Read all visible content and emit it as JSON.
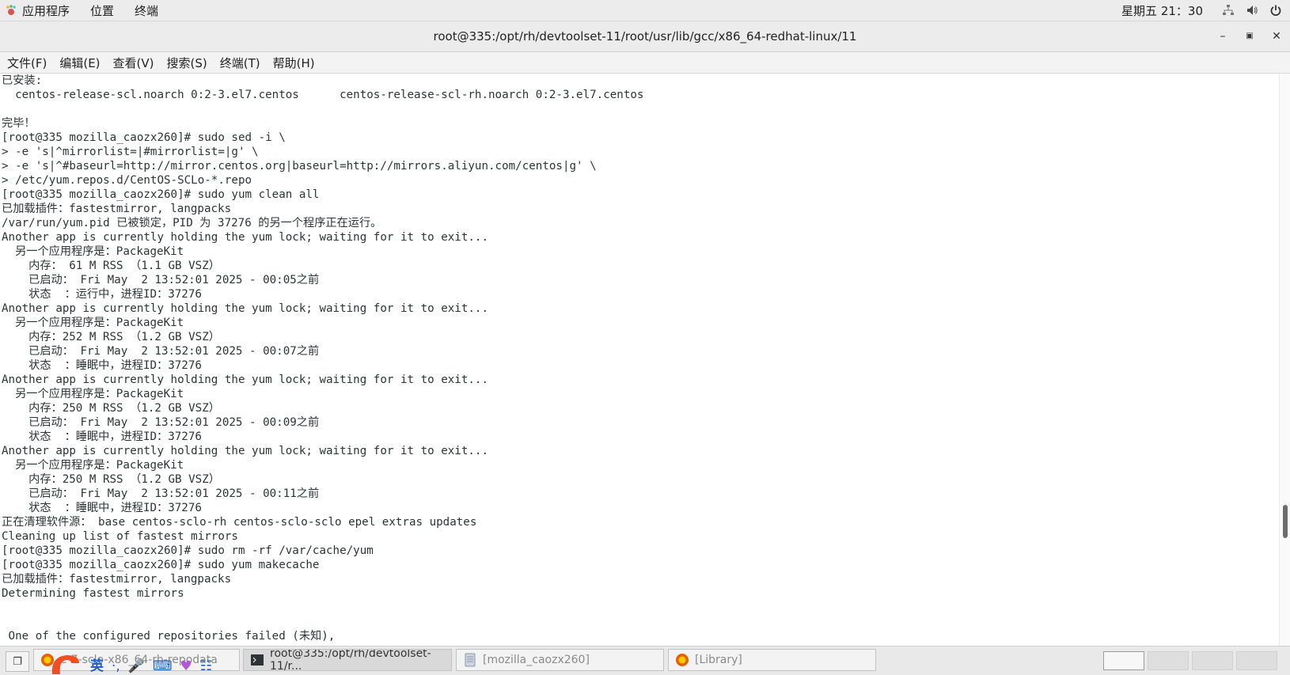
{
  "topbar": {
    "applications": "应用程序",
    "places": "位置",
    "terminal": "终端",
    "clock": "星期五 21：30"
  },
  "window": {
    "title": "root@335:/opt/rh/devtoolset-11/root/usr/lib/gcc/x86_64-redhat-linux/11"
  },
  "menubar": {
    "items": [
      "文件(F)",
      "编辑(E)",
      "查看(V)",
      "搜索(S)",
      "终端(T)",
      "帮助(H)"
    ]
  },
  "terminal": {
    "lines": [
      "已安装:",
      "  centos-release-scl.noarch 0:2-3.el7.centos      centos-release-scl-rh.noarch 0:2-3.el7.centos",
      "",
      "完毕！",
      "[root@335 mozilla_caozx260]# sudo sed -i \\",
      "> -e 's|^mirrorlist=|#mirrorlist=|g' \\",
      "> -e 's|^#baseurl=http://mirror.centos.org|baseurl=http://mirrors.aliyun.com/centos|g' \\",
      "> /etc/yum.repos.d/CentOS-SCLo-*.repo",
      "[root@335 mozilla_caozx260]# sudo yum clean all",
      "已加载插件：fastestmirror, langpacks",
      "/var/run/yum.pid 已被锁定，PID 为 37276 的另一个程序正在运行。",
      "Another app is currently holding the yum lock; waiting for it to exit...",
      "  另一个应用程序是：PackageKit",
      "    内存： 61 M RSS （1.1 GB VSZ）",
      "    已启动： Fri May  2 13:52:01 2025 - 00:05之前",
      "    状态  ：运行中，进程ID：37276",
      "Another app is currently holding the yum lock; waiting for it to exit...",
      "  另一个应用程序是：PackageKit",
      "    内存：252 M RSS （1.2 GB VSZ）",
      "    已启动： Fri May  2 13:52:01 2025 - 00:07之前",
      "    状态  ：睡眠中，进程ID：37276",
      "Another app is currently holding the yum lock; waiting for it to exit...",
      "  另一个应用程序是：PackageKit",
      "    内存：250 M RSS （1.2 GB VSZ）",
      "    已启动： Fri May  2 13:52:01 2025 - 00:09之前",
      "    状态  ：睡眠中，进程ID：37276",
      "Another app is currently holding the yum lock; waiting for it to exit...",
      "  另一个应用程序是：PackageKit",
      "    内存：250 M RSS （1.2 GB VSZ）",
      "    已启动： Fri May  2 13:52:01 2025 - 00:11之前",
      "    状态  ：睡眠中，进程ID：37276",
      "正在清理软件源： base centos-sclo-rh centos-sclo-sclo epel extras updates",
      "Cleaning up list of fastest mirrors",
      "[root@335 mozilla_caozx260]# sudo rm -rf /var/cache/yum",
      "[root@335 mozilla_caozx260]# sudo yum makecache",
      "已加载插件：fastestmirror, langpacks",
      "Determining fastest mirrors",
      "",
      "",
      " One of the configured repositories failed (未知),"
    ]
  },
  "taskbar": {
    "tasks": [
      {
        "label": "e-7-sclo-x86_64-rh-repodata"
      },
      {
        "label": "root@335:/opt/rh/devtoolset-11/r..."
      },
      {
        "label": "[mozilla_caozx260]"
      },
      {
        "label": "[Library]"
      }
    ],
    "ime_label": "英"
  }
}
